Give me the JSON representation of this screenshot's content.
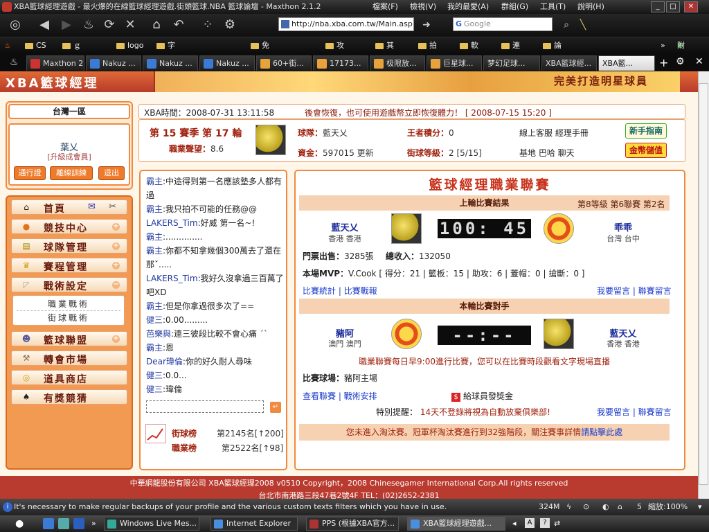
{
  "window": {
    "title": "XBA籃球經理遊戲 - 最火爆的在線籃球經理遊戲.街頭籃球.NBA 籃球論壇 - Maxthon 2.1.2"
  },
  "menu": [
    "檔案(F)",
    "檢視(V)",
    "我的最愛(A)",
    "群組(G)",
    "工具(T)",
    "說明(H)"
  ],
  "toolbar": {
    "url": "http://nba.xba.com.tw/Main.asp",
    "search_placeholder": "Google"
  },
  "favorites": [
    "CS",
    "ｇａｍｅ",
    "logo",
    "字典同詞典and百科",
    "免費圖片上傳",
    "攻略網",
    "其他",
    "拍片",
    "軟件",
    "連結",
    "論壇"
  ],
  "favorites_add": "附加",
  "tabs": [
    "Maxthon 2 ...",
    "Nakuz ...",
    "Nakuz ...",
    "Nakuz ...",
    "60+街...",
    "17173...",
    "极限放...",
    "巨星球...",
    "梦幻足球...",
    "XBA籃球經...",
    "XBA籃..."
  ],
  "banner": {
    "logo_text": "XBA籃球經理",
    "slogan": "完美打造明星球員"
  },
  "sidebar": {
    "region": "台灣一區",
    "user_name": "葉乂",
    "user_upgrade": "[升級成會員]",
    "buttons": [
      "通行證",
      "離線訓練",
      "退出"
    ],
    "nav": [
      {
        "label": "首頁"
      },
      {
        "label": "競技中心"
      },
      {
        "label": "球隊管理"
      },
      {
        "label": "賽程管理"
      },
      {
        "label": "戰術設定"
      },
      {
        "label": "籃球聯盟"
      },
      {
        "label": "轉會市場"
      },
      {
        "label": "道具商店"
      },
      {
        "label": "有獎競猜"
      }
    ],
    "sub_nav": [
      "職業戰術",
      "街球戰術"
    ]
  },
  "info": {
    "time_label": "XBA時間：",
    "time_value": "2008-07-31 13:11:58",
    "notice": "後會恢復，也可使用遊戲幣立即恢復體力！ [ 2008-07-15 15:20 ]",
    "season": "第 15 賽季 第 17 輪",
    "pro_label": "職業聲望：",
    "pro_value": "8.6",
    "team_label": "球隊：",
    "team_value": "藍天乂",
    "king_label": "王者積分：",
    "king_value": "0",
    "service": "線上客服 經理手冊",
    "newbie_btn": "新手指南",
    "fund_label": "資金：",
    "fund_value": "597015",
    "update": "更新",
    "street_label": "街球等級：",
    "street_value": "2 [5/15]",
    "base": "基地 巴哈 聊天",
    "coin_btn": "金幣儲值"
  },
  "chat": {
    "messages": [
      {
        "name": "霸主",
        "text": ":中途得到第一名應該墊多人都有過"
      },
      {
        "name": "霸主",
        "text": ":我只拍不可能的任務@@"
      },
      {
        "name": "LAKERS_Tim",
        "text": ":好威 第一名~!"
      },
      {
        "name": "霸主",
        "text": ":.............."
      },
      {
        "name": "霸主",
        "text": ":你都不知拿幾個300萬去了還在那ˇ....."
      },
      {
        "name": "LAKERS_Tim",
        "text": ":我好久沒拿過三百萬了吧XD"
      },
      {
        "name": "霸主",
        "text": ":但是你拿過很多次了=="
      },
      {
        "name": "健三",
        "text": ":0.00........."
      },
      {
        "name": "芭樂與",
        "text": ":連三彼段比較不會心痛 ˊˋ"
      },
      {
        "name": "霸主",
        "text": ":恩"
      },
      {
        "name": "Dear瑋倫",
        "text": ":你的好久耐人尋味"
      },
      {
        "name": "健三",
        "text": ":0.0..."
      },
      {
        "name": "健三",
        "text": ":瑋倫"
      }
    ],
    "street_rank_label": "街球榜",
    "street_rank_value": "第2145名[↑200]",
    "pro_rank_label": "職業榜",
    "pro_rank_value": "第2522名[↑98]"
  },
  "league": {
    "title": "籃球經理職業聯賽",
    "last_title": "上輪比賽結果",
    "last_meta": "第8等級 第6聯賽 第2名",
    "last_home": "藍天乂",
    "last_home_loc": "香港 香港",
    "last_away": "乖乖",
    "last_away_loc": "台灣 台中",
    "score": "100: 45",
    "ticket_label": "門票出售：",
    "ticket_value": "3285張",
    "income_label": "總收入：",
    "income_value": "132050",
    "mvp_label": "本場MVP：",
    "mvp_value": "V.Cook [ 得分：21 | 籃板：15 | 助攻：6 | 蓋帽：0 | 搶斷：0 ]",
    "links_left": "比賽統計 | 比賽戰報",
    "links_right": "我要留言 | 聯賽留言",
    "next_title": "本輪比賽對手",
    "next_home": "豬阿",
    "next_home_loc": "澳門 澳門",
    "next_away": "藍天乂",
    "next_away_loc": "香港 香港",
    "next_score": "--:--",
    "schedule_note": "職業聯賽每日早9:00進行比賽，您可以在比賽時段觀看文字現場直播",
    "court_label": "比賽球場：",
    "court_value": "豬阿主場",
    "links2_left": "查看聯賽 | 戰術安排",
    "bonus": "給球員發獎金",
    "remind_label": "特別提醒：",
    "remind_value": "14天不登錄將視為自動放棄俱樂部!",
    "links2_right": "我要留言 | 聯賽留言",
    "cup_note": "您未進入淘汰賽。冠軍杯淘汰賽進行到32強階段，關注賽事詳情",
    "cup_link": "請點擊此處"
  },
  "footer": {
    "line1": "中華網龍股份有限公司 XBA籃球經理2008 v0510   Copyright，2008 Chinesegamer International Corp.All rights reserved",
    "line2": "台北市南港路三段47巷2號4F TEL：(02)2652-2381"
  },
  "statusbar": {
    "message": "It's necessary to make regular backups of your profile and the various custom texts filters which you have in use.",
    "memory": "324M",
    "page_count": "5",
    "zoom": "縮放:100%"
  },
  "taskbar": {
    "tasks": [
      "Windows Live Mes...",
      "Internet Explorer",
      "PPS (根據XBA官方...",
      "XBA籃球經理遊戲..."
    ]
  }
}
